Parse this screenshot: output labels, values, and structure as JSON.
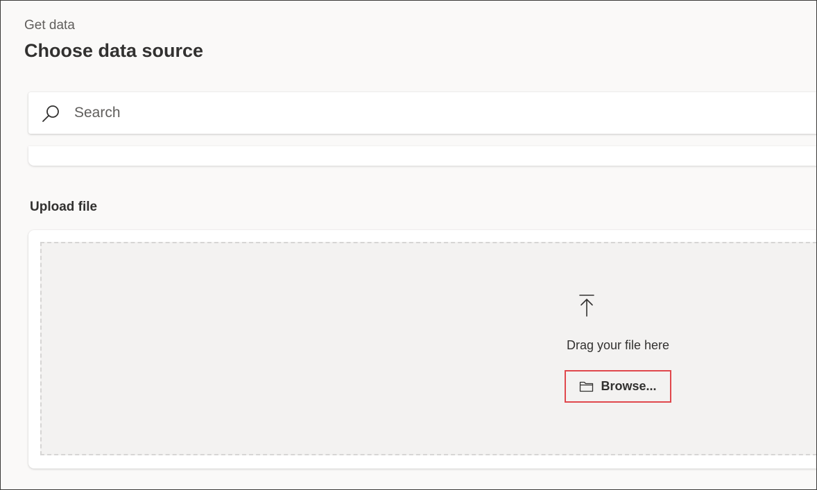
{
  "header": {
    "breadcrumb": "Get data",
    "title": "Choose data source"
  },
  "search": {
    "placeholder": "Search",
    "icon": "search-icon"
  },
  "upload": {
    "section_title": "Upload file",
    "drag_text": "Drag your file here",
    "browse_label": "Browse...",
    "upload_icon": "upload-arrow-icon",
    "folder_icon": "folder-icon"
  },
  "colors": {
    "background": "#faf9f8",
    "card": "#ffffff",
    "drop_zone": "#f3f2f1",
    "highlight_border": "#e0474c",
    "text": "#323130",
    "secondary_text": "#605e5c"
  }
}
